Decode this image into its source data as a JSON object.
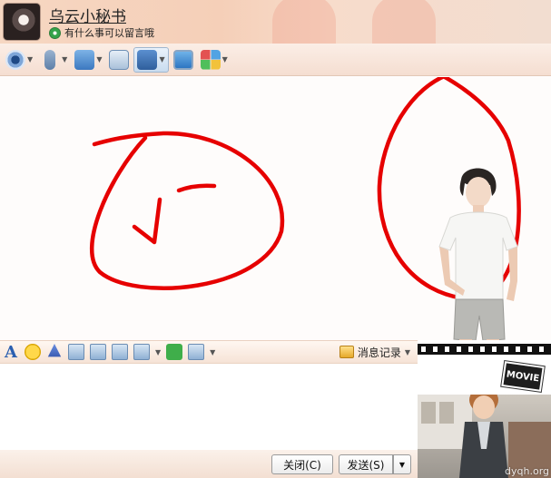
{
  "header": {
    "contact_name": "乌云小秘书",
    "status_message": "有什么事可以留言哦"
  },
  "toolbar": {
    "items": [
      {
        "name": "video-call",
        "icon": "camera-icon"
      },
      {
        "name": "voice-call",
        "icon": "microphone-icon"
      },
      {
        "name": "send-file",
        "icon": "folder-transfer-icon"
      },
      {
        "name": "add-app",
        "icon": "add-app-icon"
      },
      {
        "name": "screen-share",
        "icon": "screen-share-icon"
      },
      {
        "name": "remote-desktop",
        "icon": "remote-desktop-icon"
      },
      {
        "name": "app-center",
        "icon": "apps-grid-icon"
      }
    ]
  },
  "format_bar": {
    "history_label": "消息记录"
  },
  "buttons": {
    "close_label": "关闭(C)",
    "send_label": "发送(S)"
  },
  "show_panel": {
    "movie_label": "MOVIE",
    "watermark": "dyqh.org"
  },
  "colors": {
    "scribble": "#e60000"
  }
}
